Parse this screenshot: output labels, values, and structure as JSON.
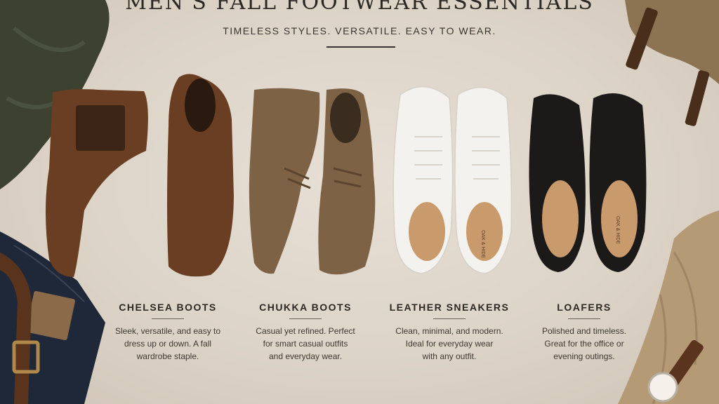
{
  "header": {
    "title": "MEN'S FALL FOOTWEAR ESSENTIALS",
    "subtitle": "TIMELESS STYLES. VERSATILE. EASY TO WEAR."
  },
  "categories": [
    {
      "name": "CHELSEA BOOTS",
      "desc": "Sleek, versatile, and easy to\ndress up or down. A fall\nwardrobe staple."
    },
    {
      "name": "CHUKKA BOOTS",
      "desc": "Casual yet refined. Perfect\nfor smart casual outfits\nand everyday wear."
    },
    {
      "name": "LEATHER SNEAKERS",
      "desc": "Clean, minimal, and modern.\nIdeal for everyday wear\nwith any outfit."
    },
    {
      "name": "LOAFERS",
      "desc": "Polished and timeless.\nGreat for the office or\nevening outings."
    }
  ],
  "insole_brand": "OAK & HIDE",
  "colors": {
    "background": "#ddd3c7",
    "chelsea": "#6a3e22",
    "chukka": "#7d6246",
    "sneaker": "#f4f2ee",
    "loafer": "#1c1a19"
  }
}
